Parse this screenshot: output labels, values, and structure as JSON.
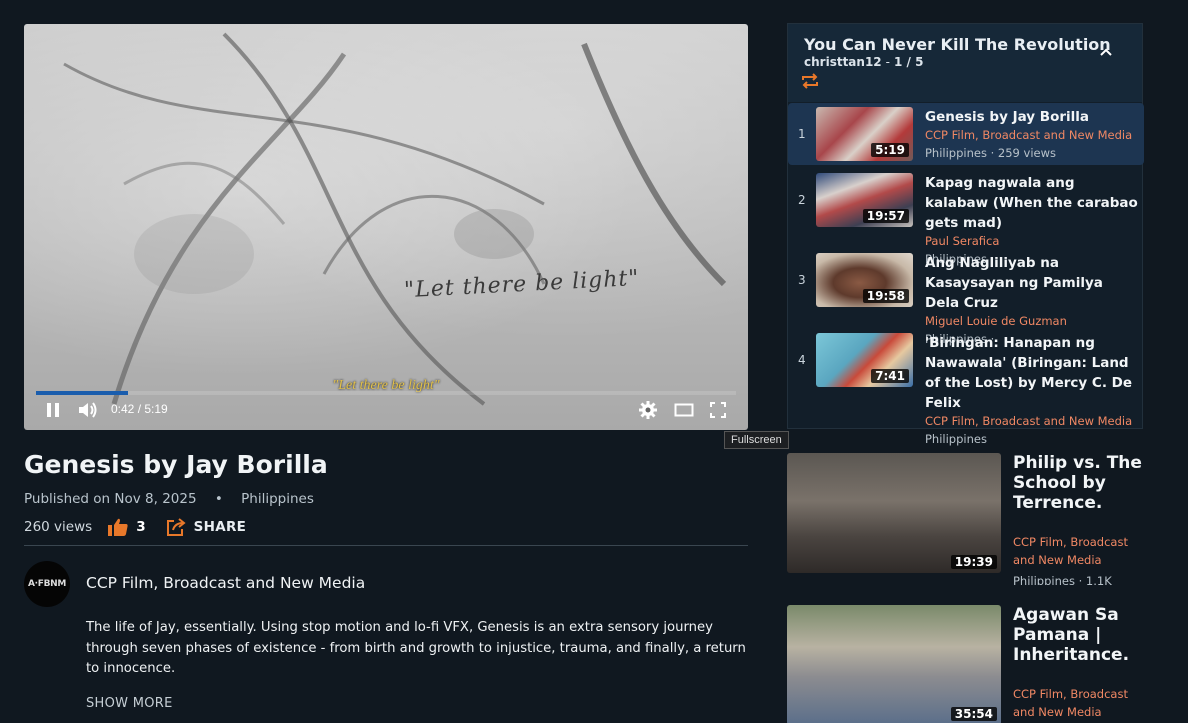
{
  "player": {
    "frame_text": "\"Let there be light\"",
    "subtitle": "\"Let there be light\"",
    "time": "0:42 / 5:19",
    "progress": 0.132,
    "tooltip": "Fullscreen"
  },
  "video": {
    "title": "Genesis by Jay Borilla",
    "published": "Published on Nov 8, 2025",
    "dot": "•",
    "country": "Philippines",
    "views": "260 views",
    "likes": "3",
    "share_label": "SHARE",
    "channel_name": "CCP Film, Broadcast and New Media",
    "channel_avatar_text": "A·FBNM",
    "description": "The life of Jay, essentially. Using stop motion and lo-fi VFX, Genesis is an extra sensory journey through seven phases of existence - from birth and growth to injustice, trauma, and finally, a return to innocence.",
    "show_more": "SHOW MORE"
  },
  "playlist": {
    "title": "You Can Never Kill The Revolution",
    "owner": "christtan12",
    "sep": "-",
    "position": "1 / 5",
    "items": [
      {
        "num": "1",
        "title": "Genesis by Jay Borilla",
        "channel": "CCP Film, Broadcast and New Media",
        "info": "Philippines · 259 views",
        "duration": "5:19"
      },
      {
        "num": "2",
        "title": "Kapag nagwala ang kalabaw (When the carabao gets mad)",
        "channel": "Paul Serafica",
        "info": "Philippines ·",
        "duration": "19:57"
      },
      {
        "num": "3",
        "title": "Ang Nagliliyab na Kasaysayan ng Pamilya Dela Cruz",
        "channel": "Miguel Louie de Guzman",
        "info": "Philippines ·",
        "duration": "19:58"
      },
      {
        "num": "4",
        "title": "'Biringan: Hanapan ng Nawawala' (Biringan: Land of the Lost) by Mercy C. De Felix",
        "channel": "CCP Film, Broadcast and New Media",
        "info": "Philippines",
        "duration": "7:41"
      }
    ]
  },
  "recommended": [
    {
      "title": "Philip vs. The School by Terrence.",
      "channel": "CCP Film, Broadcast and New Media",
      "info": "Philippines · 1.1K",
      "duration": "19:39"
    },
    {
      "title": "Agawan Sa Pamana | Inheritance.",
      "channel": "CCP Film, Broadcast and New Media",
      "info": "",
      "duration": "35:54"
    }
  ],
  "colors": {
    "accent": "#f08864",
    "progress": "#1a5dad",
    "like": "#e8782a",
    "active_row": "#1d3551"
  }
}
